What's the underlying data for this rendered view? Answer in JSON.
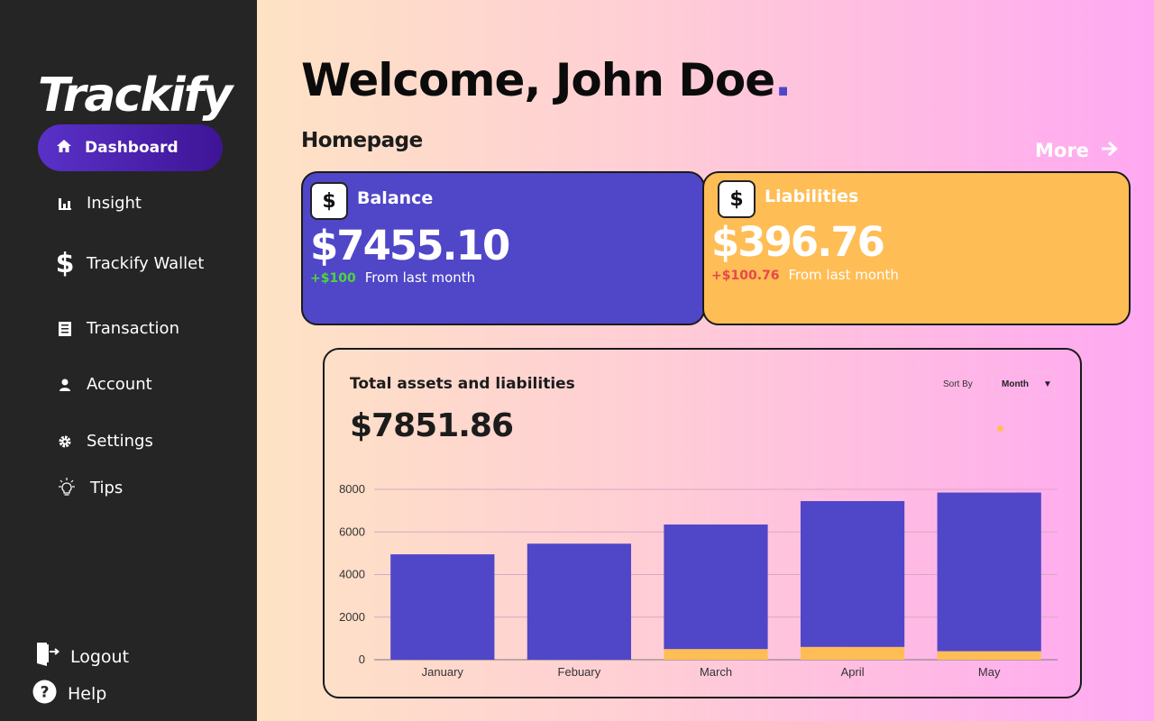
{
  "sidebar": {
    "logo": "Trackify",
    "active_item": "Dashboard",
    "items": [
      {
        "label": "Insight",
        "icon": "bar-chart-icon"
      },
      {
        "label": "Trackify Wallet",
        "icon": "dollar-icon"
      },
      {
        "label": "Transaction",
        "icon": "receipt-icon"
      },
      {
        "label": "Account",
        "icon": "user-icon"
      },
      {
        "label": "Settings",
        "icon": "gear-icon"
      },
      {
        "label": "Tips",
        "icon": "lightbulb-icon"
      }
    ],
    "logout": "Logout",
    "help": "Help"
  },
  "header": {
    "welcome": "Welcome, John Doe",
    "welcome_dot": ".",
    "section": "Homepage",
    "more": "More"
  },
  "cards": {
    "balance": {
      "icon_symbol": "$",
      "title": "Balance",
      "amount": "$7455.10",
      "delta": "+$100",
      "note": "From last month"
    },
    "liabilities": {
      "icon_symbol": "$",
      "title": "Liabilities",
      "amount": "$396.76",
      "delta": "+$100.76",
      "note": "From last month"
    }
  },
  "chart_panel": {
    "title": "Total assets and liabilities",
    "total": "$7851.86",
    "sort_label": "Sort By",
    "sort_value": "Month",
    "sort_arrow": "▼"
  },
  "colors": {
    "accent": "#5046c8",
    "liabilities": "#ffbd55",
    "sidebar_bg": "#252525"
  },
  "chart_data": {
    "type": "bar",
    "stacked": true,
    "categories": [
      "January",
      "Febuary",
      "March",
      "April",
      "May"
    ],
    "series": [
      {
        "values": [
          4950,
          5450,
          5850,
          6850,
          7450
        ],
        "color": "#5046c8"
      },
      {
        "values": [
          0,
          0,
          500,
          600,
          400
        ],
        "color": "#ffbd55"
      }
    ],
    "yticks": [
      0,
      2000,
      4000,
      6000,
      8000
    ],
    "ylim": [
      0,
      8000
    ],
    "grid": true
  }
}
